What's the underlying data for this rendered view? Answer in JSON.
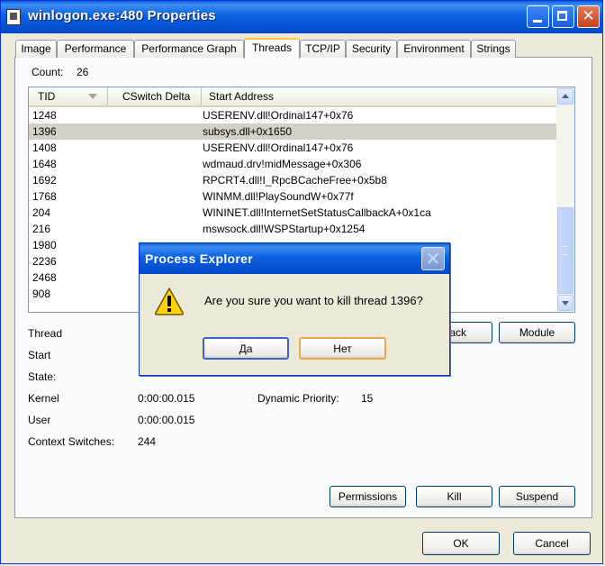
{
  "window": {
    "title": "winlogon.exe:480 Properties",
    "close_glyph": "✕"
  },
  "tabs": [
    "Image",
    "Performance",
    "Performance Graph",
    "Threads",
    "TCP/IP",
    "Security",
    "Environment",
    "Strings"
  ],
  "active_tab": "Threads",
  "count": {
    "label": "Count:",
    "value": "26"
  },
  "table": {
    "columns": [
      "TID",
      "CSwitch Delta",
      "Start Address"
    ],
    "rows": [
      {
        "tid": "1248",
        "addr": "USERENV.dll!Ordinal147+0x76"
      },
      {
        "tid": "1396",
        "addr": "subsys.dll+0x1650",
        "selected": true
      },
      {
        "tid": "1408",
        "addr": "USERENV.dll!Ordinal147+0x76"
      },
      {
        "tid": "1648",
        "addr": "wdmaud.drv!midMessage+0x306"
      },
      {
        "tid": "1692",
        "addr": "RPCRT4.dll!I_RpcBCacheFree+0x5b8"
      },
      {
        "tid": "1768",
        "addr": "WINMM.dll!PlaySoundW+0x77f"
      },
      {
        "tid": "204",
        "addr": "WININET.dll!InternetSetStatusCallbackA+0x1ca"
      },
      {
        "tid": "216",
        "addr": "mswsock.dll!WSPStartup+0x1254"
      },
      {
        "tid": "1980",
        "addr": ""
      },
      {
        "tid": "2236",
        "addr": ""
      },
      {
        "tid": "2468",
        "addr": ""
      },
      {
        "tid": "908",
        "addr": ""
      }
    ]
  },
  "details": {
    "thread_label": "Thread",
    "start_label": "Start",
    "state_label": "State:",
    "kernel_label": "Kernel",
    "kernel_value": "0:00:00.015",
    "user_label": "User",
    "user_value": "0:00:00.015",
    "dynamic_priority_label": "Dynamic Priority:",
    "dynamic_priority_value": "15",
    "context_switches_label": "Context Switches:",
    "context_switches_value": "244"
  },
  "buttons": {
    "stack_label_visible": "ack",
    "module": "Module",
    "permissions": "Permissions",
    "kill": "Kill",
    "suspend": "Suspend",
    "ok": "OK",
    "cancel": "Cancel"
  },
  "dialog": {
    "title": "Process Explorer",
    "message": "Are you sure you want to kill thread 1396?",
    "yes": "Да",
    "no": "Нет",
    "close_glyph": "✕"
  },
  "colors": {
    "title_blue": "#0348c9",
    "face": "#ece9d8",
    "tab_highlight": "#ffc83c",
    "selected_row": "#d4d0c8"
  }
}
